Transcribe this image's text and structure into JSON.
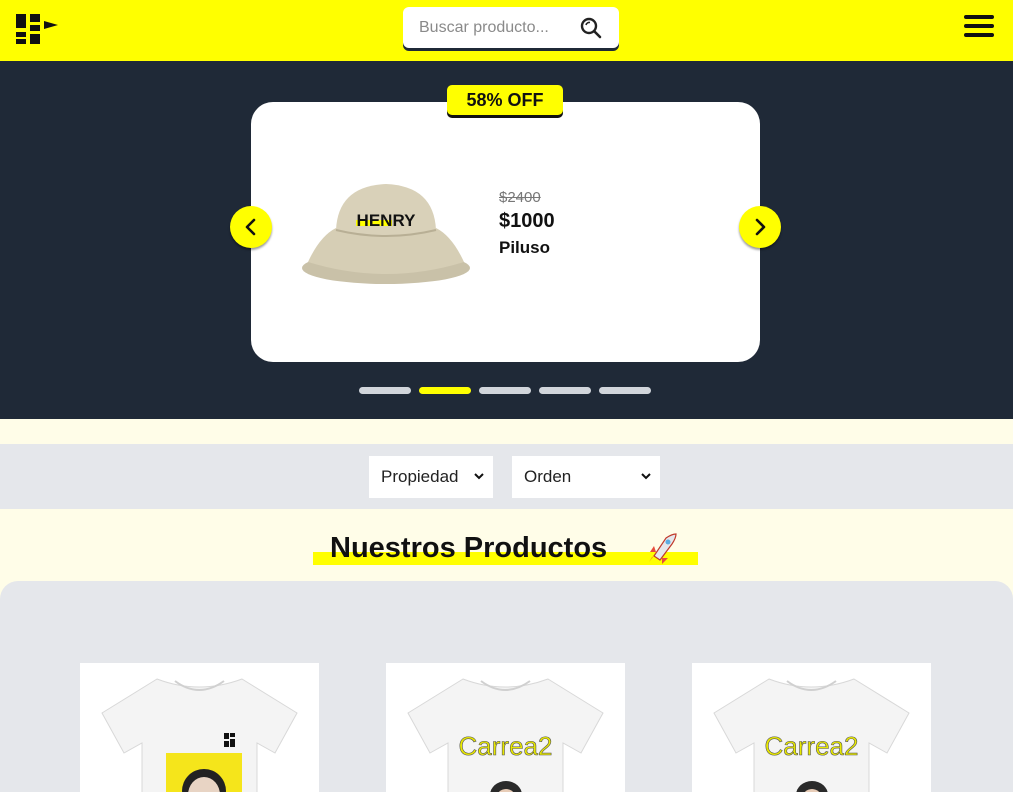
{
  "header": {
    "logo_icon": "henry-logo-icon",
    "search_placeholder": "Buscar producto...",
    "search_icon": "search-icon",
    "menu_icon": "hamburger-menu-icon"
  },
  "carousel": {
    "discount_badge": "58% OFF",
    "product": {
      "image_icon": "bucket-hat-image",
      "hat_print": "HENRY",
      "old_price": "$2400",
      "price": "$1000",
      "name": "Piluso"
    },
    "prev_icon": "chevron-left-icon",
    "next_icon": "chevron-right-icon",
    "dots_count": 5,
    "active_dot": 2
  },
  "filters": {
    "property_select": "Propiedad",
    "order_select": "Orden"
  },
  "section": {
    "title": "Nuestros Productos",
    "title_icon": "rocket-icon"
  },
  "products": [
    {
      "image": "tshirt-henry-logo-portrait"
    },
    {
      "image": "tshirt-carrea2",
      "print": "Carrea2"
    },
    {
      "image": "tshirt-carrea2",
      "print": "Carrea2"
    }
  ],
  "colors": {
    "accent": "#ffff00",
    "dark": "#1f2937",
    "panel": "#e5e7eb",
    "page": "#fffde8"
  }
}
